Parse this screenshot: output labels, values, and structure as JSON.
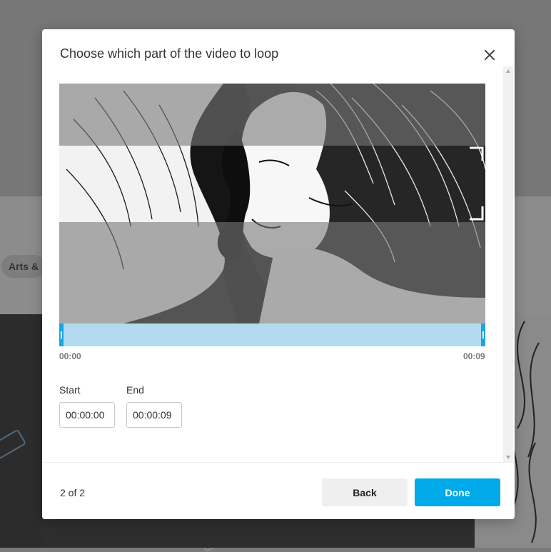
{
  "background": {
    "chip_label": "Arts &"
  },
  "modal": {
    "title": "Choose which part of the video to loop",
    "close_icon": "close-icon"
  },
  "video": {
    "thumbnail": "artwork-two-faces-kissing",
    "crop_icon": "crop-corners-icon"
  },
  "timeline": {
    "start_time": "00:00",
    "end_time": "00:09",
    "selection_start_fraction": 0,
    "selection_end_fraction": 1
  },
  "fields": {
    "start_label": "Start",
    "start_value": "00:00:00",
    "end_label": "End",
    "end_value": "00:00:09"
  },
  "footer": {
    "step": "2 of 2",
    "back_label": "Back",
    "done_label": "Done"
  },
  "colors": {
    "accent": "#00a9e8",
    "timeline_fill": "#b2daf0",
    "handle": "#1aa6e0"
  }
}
